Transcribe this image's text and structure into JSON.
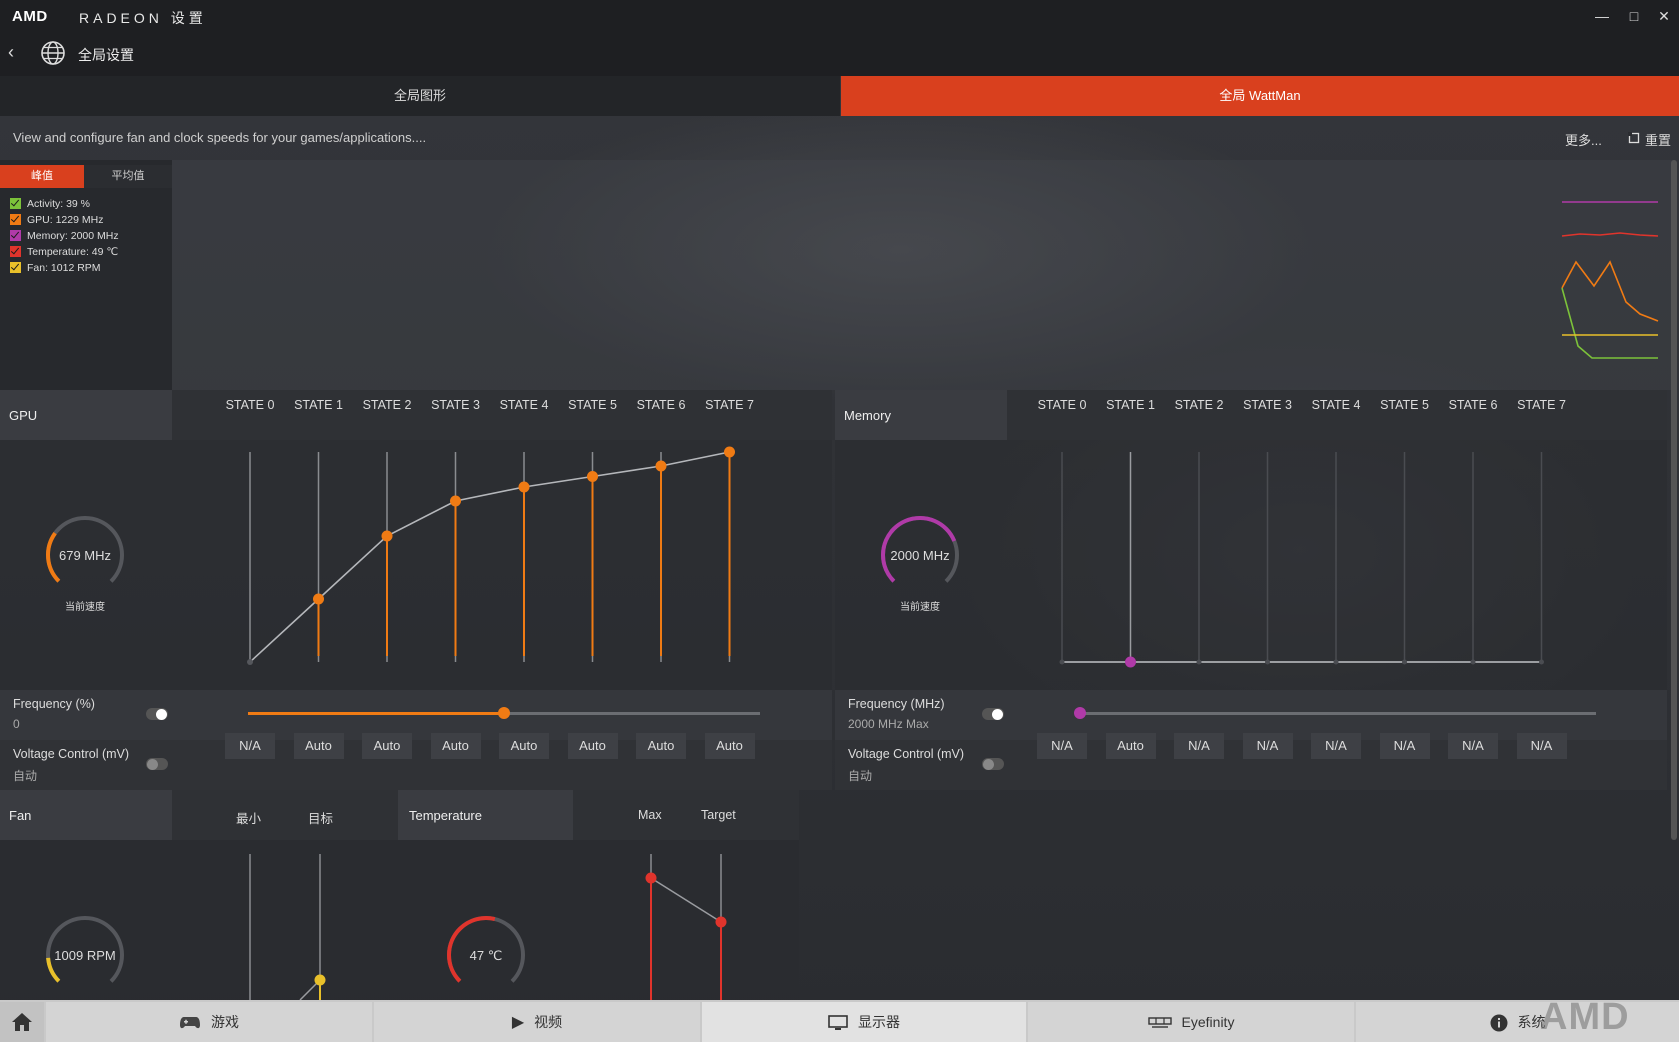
{
  "titlebar": {
    "brand": "AMD",
    "title": "RADEON 设置"
  },
  "breadcrumb": {
    "title": "全局设置"
  },
  "tabs": [
    {
      "label": "全局图形",
      "active": false
    },
    {
      "label": "全局 WattMan",
      "active": true
    }
  ],
  "description": "View and configure fan and clock speeds for your games/applications....",
  "header_actions": {
    "more": "更多...",
    "reset": "重置"
  },
  "monitor": {
    "peak_label": "峰值",
    "avg_label": "平均值",
    "legend": [
      {
        "label": "Activity: 39 %",
        "color": "#7cc23a"
      },
      {
        "label": "GPU: 1229 MHz",
        "color": "#f07b14"
      },
      {
        "label": "Memory: 2000 MHz",
        "color": "#b03aa8"
      },
      {
        "label": "Temperature: 49 ℃",
        "color": "#e0342c"
      },
      {
        "label": "Fan: 1012 RPM",
        "color": "#e8c02a"
      }
    ]
  },
  "gpu": {
    "title": "GPU",
    "gauge_value": "679 MHz",
    "gauge_caption": "当前速度",
    "gauge_fraction": 0.3,
    "states": [
      "STATE 0",
      "STATE 1",
      "STATE 2",
      "STATE 3",
      "STATE 4",
      "STATE 5",
      "STATE 6",
      "STATE 7"
    ],
    "state_levels": [
      0.0,
      0.18,
      0.36,
      0.46,
      0.5,
      0.53,
      0.56,
      0.6
    ],
    "frequency_label": "Frequency (%)",
    "frequency_value": "0",
    "frequency_slider_fraction": 0.5,
    "voltage_label": "Voltage Control (mV)",
    "voltage_mode": "自动",
    "voltage_values": [
      "N/A",
      "Auto",
      "Auto",
      "Auto",
      "Auto",
      "Auto",
      "Auto",
      "Auto"
    ],
    "accent": "#f07b14"
  },
  "memory": {
    "title": "Memory",
    "gauge_value": "2000 MHz",
    "gauge_caption": "当前速度",
    "gauge_fraction": 0.75,
    "states": [
      "STATE 0",
      "STATE 1",
      "STATE 2",
      "STATE 3",
      "STATE 4",
      "STATE 5",
      "STATE 6",
      "STATE 7"
    ],
    "frequency_label": "Frequency (MHz)",
    "frequency_value": "2000 MHz Max",
    "frequency_slider_fraction": 0.0,
    "voltage_label": "Voltage Control (mV)",
    "voltage_mode": "自动",
    "voltage_values": [
      "N/A",
      "Auto",
      "N/A",
      "N/A",
      "N/A",
      "N/A",
      "N/A",
      "N/A"
    ],
    "accent": "#b03aa8"
  },
  "fan": {
    "title": "Fan",
    "col_min": "最小",
    "col_target": "目标",
    "gauge_value": "1009 RPM",
    "gauge_fraction": 0.15,
    "accent": "#e8c02a"
  },
  "temperature": {
    "title": "Temperature",
    "col_max": "Max",
    "col_target": "Target",
    "gauge_value": "47 ℃",
    "gauge_fraction": 0.55,
    "accent": "#e0342c"
  },
  "nav": {
    "games": "游戏",
    "video": "视频",
    "display": "显示器",
    "eyefinity": "Eyefinity",
    "system": "系统",
    "watermark": "AMD"
  }
}
